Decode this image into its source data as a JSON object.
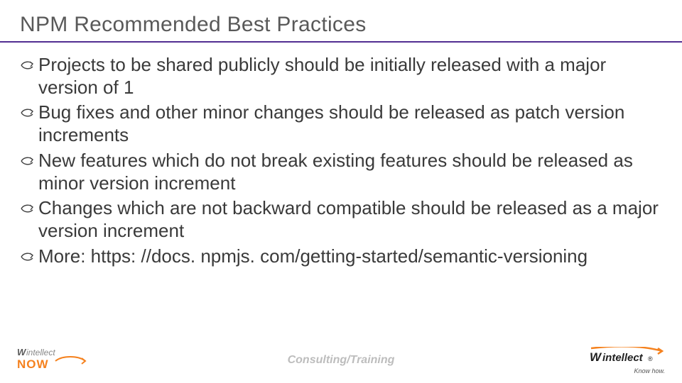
{
  "title": "NPM Recommended Best Practices",
  "bullets": [
    "Projects to be shared publicly should be initially released with a major version of 1",
    "Bug fixes and other minor changes should be released as patch version increments",
    "New features which do not break existing features should be released as minor version increment",
    "Changes which are not backward compatible should be released as a major version increment",
    "More: https: //docs. npmjs. com/getting-started/semantic-versioning"
  ],
  "footer": {
    "center": "Consulting/Training",
    "left_logo": {
      "top": "Wintellect",
      "bottom": "NOW"
    },
    "right_logo": {
      "name": "Wintellect",
      "tagline": "Know how."
    }
  },
  "colors": {
    "accent": "#522e91",
    "orange": "#f5821f",
    "text": "#3a3a3a"
  }
}
